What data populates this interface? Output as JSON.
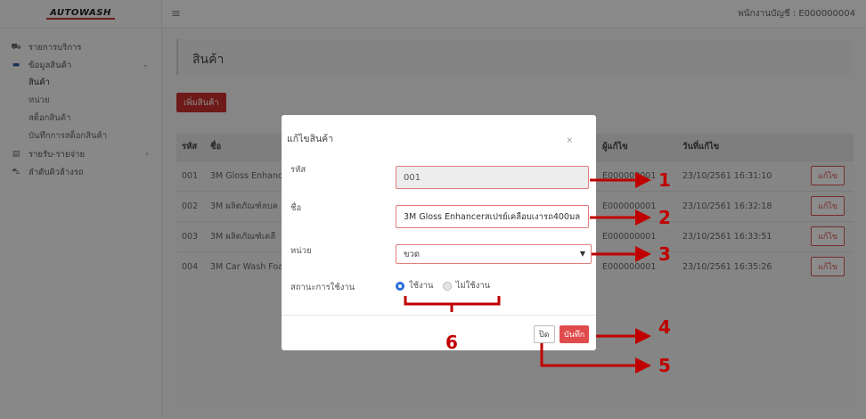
{
  "sidebar": {
    "logo": "AUTOWASH",
    "items": [
      {
        "label": "รายการบริการ",
        "icon": "car-service-icon"
      },
      {
        "label": "ข้อมูลสินค้า",
        "icon": "box-icon",
        "chevron": "⌄"
      }
    ],
    "sub_items": [
      "สินค้า",
      "หน่วย",
      "สต็อกสินค้า",
      "บันทึกการสต็อกสินค้า"
    ],
    "items_after": [
      {
        "label": "รายรับ-รายจ่าย",
        "icon": "receipt-icon",
        "chevron": "›"
      },
      {
        "label": "ลำดับคิวล้างรถ",
        "icon": "car-icon"
      }
    ]
  },
  "topbar": {
    "menu_icon": "≡",
    "user": "พนักงานบัญชี : E000000004"
  },
  "page": {
    "title": "สินค้า",
    "add_button": "เพิ่มสินค้า"
  },
  "table": {
    "headers": [
      "รหัส",
      "ชื่อ",
      "ผู้แก้ไข",
      "วันที่แก้ไข",
      ""
    ],
    "rows": [
      {
        "code": "001",
        "name": "3M Gloss Enhanc",
        "by": "E000000001",
        "date": "23/10/2561 16:31:10",
        "action": "แก้ไข"
      },
      {
        "code": "002",
        "name": "3M ผลิตภัณฑ์ลบค",
        "by": "E000000001",
        "date": "23/10/2561 16:32:18",
        "action": "แก้ไข"
      },
      {
        "code": "003",
        "name": "3M ผลิตภัณฑ์เคลื",
        "by": "E000000001",
        "date": "23/10/2561 16:33:51",
        "action": "แก้ไข"
      },
      {
        "code": "004",
        "name": "3M Car Wash Foa",
        "by": "E000000001",
        "date": "23/10/2561 16:35:26",
        "action": "แก้ไข"
      }
    ]
  },
  "modal": {
    "title": "แก้ไขสินค้า",
    "close_icon": "×",
    "fields": {
      "code_label": "รหัส",
      "code_value": "001",
      "name_label": "ชื่อ",
      "name_value": "3M Gloss Enhancerสเปรย์เคลือบเงารถ400มล",
      "unit_label": "หน่วย",
      "unit_value": "ขวด",
      "status_label": "สถานะการใช้งาน",
      "status_on": "ใช้งาน",
      "status_off": "ไม่ใช้งาน"
    },
    "close_button": "ปิด",
    "save_button": "บันทึก"
  },
  "annotations": {
    "labels": [
      "1",
      "2",
      "3",
      "4",
      "5",
      "6"
    ],
    "color": "#c00000"
  }
}
